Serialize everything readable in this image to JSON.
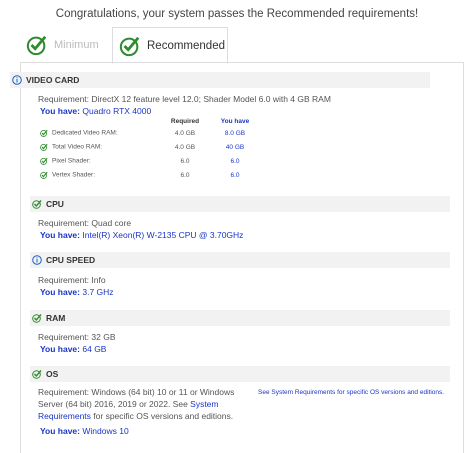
{
  "banner": "Congratulations, your system passes the Recommended requirements!",
  "tabs": {
    "minimum": "Minimum",
    "recommended": "Recommended"
  },
  "video": {
    "title": "VIDEO CARD",
    "requirement": "Requirement: DirectX 12 feature level 12.0; Shader Model 6.0 with 4 GB RAM",
    "have_label": "You have:",
    "have_value": "Quadro RTX 4000",
    "col_required": "Required",
    "col_have": "You have",
    "rows": [
      {
        "label": "Dedicated Video RAM:",
        "required": "4.0 GB",
        "have": "8.0 GB"
      },
      {
        "label": "Total Video RAM:",
        "required": "4.0 GB",
        "have": "40 GB"
      },
      {
        "label": "Pixel Shader:",
        "required": "6.0",
        "have": "6.0"
      },
      {
        "label": "Vertex Shader:",
        "required": "6.0",
        "have": "6.0"
      }
    ]
  },
  "cpu": {
    "title": "CPU",
    "requirement": "Requirement: Quad core",
    "have_label": "You have:",
    "have_value": "Intel(R) Xeon(R) W-2135 CPU @ 3.70GHz"
  },
  "cpu_speed": {
    "title": "CPU SPEED",
    "requirement": "Requirement: Info",
    "have_label": "You have:",
    "have_value": "3.7 GHz"
  },
  "ram": {
    "title": "RAM",
    "requirement": "Requirement: 32 GB",
    "have_label": "You have:",
    "have_value": "64 GB"
  },
  "os": {
    "title": "OS",
    "req_part1": "Requirement: Windows (64 bit) 10 or 11 or Windows Server (64 bit) 2016, 2019 or 2022. See ",
    "req_link": "System Requirements",
    "req_part2": " for specific OS versions and editions.",
    "note": "See System Requirements for specific OS versions and editions.",
    "have_label": "You have:",
    "have_value": "Windows 10"
  },
  "colors": {
    "pass_green": "#2e8b2e",
    "link_blue": "#1a35c8",
    "info_blue": "#1a5fc8"
  }
}
